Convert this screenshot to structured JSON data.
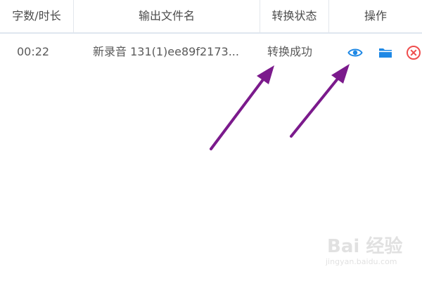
{
  "table": {
    "headers": {
      "duration": "字数/时长",
      "output_name": "输出文件名",
      "status": "转换状态",
      "actions": "操作"
    },
    "rows": [
      {
        "duration": "00:22",
        "output_name": "新录音 131(1)ee89f2173...",
        "status": "转换成功"
      }
    ]
  },
  "colors": {
    "accent_blue": "#1e88e5",
    "delete_red": "#ef4d4d",
    "arrow_purple": "#7b1a8c"
  },
  "icons": {
    "preview": "eye-icon",
    "open_folder": "folder-icon",
    "delete": "close-circle-icon"
  },
  "watermark": {
    "brand": "Bai 经验",
    "domain": "jingyan.baidu.com"
  }
}
